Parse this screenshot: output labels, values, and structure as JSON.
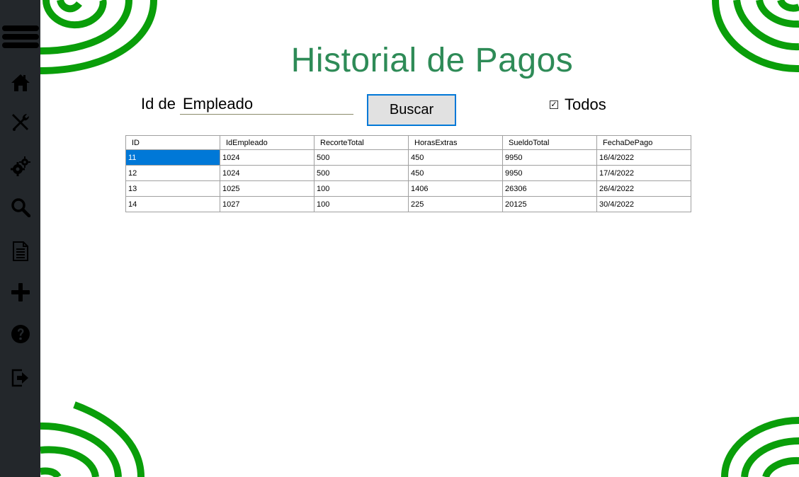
{
  "page": {
    "title": "Historial de Pagos"
  },
  "search": {
    "label": "Id de",
    "value": "Empleado",
    "button_label": "Buscar",
    "checkbox_label": "Todos",
    "checkbox_checked": true
  },
  "sidebar": {
    "items": [
      {
        "icon": "menu-icon"
      },
      {
        "icon": "home-icon"
      },
      {
        "icon": "tools-icon"
      },
      {
        "icon": "gears-icon"
      },
      {
        "icon": "search-icon"
      },
      {
        "icon": "document-icon"
      },
      {
        "icon": "plus-icon"
      },
      {
        "icon": "help-icon"
      },
      {
        "icon": "logout-icon"
      }
    ]
  },
  "table": {
    "columns": [
      "ID",
      "IdEmpleado",
      "RecorteTotal",
      "HorasExtras",
      "SueldoTotal",
      "FechaDePago"
    ],
    "rows": [
      [
        "11",
        "1024",
        "500",
        "450",
        "9950",
        "16/4/2022"
      ],
      [
        "12",
        "1024",
        "500",
        "450",
        "9950",
        "17/4/2022"
      ],
      [
        "13",
        "1025",
        "100",
        "1406",
        "26306",
        "26/4/2022"
      ],
      [
        "14",
        "1027",
        "100",
        "225",
        "20125",
        "30/4/2022"
      ]
    ]
  },
  "colors": {
    "title": "#2e8b57",
    "sidebar": "#23272b",
    "spiral": "#0a9e0a",
    "selection": "#0078d7"
  }
}
